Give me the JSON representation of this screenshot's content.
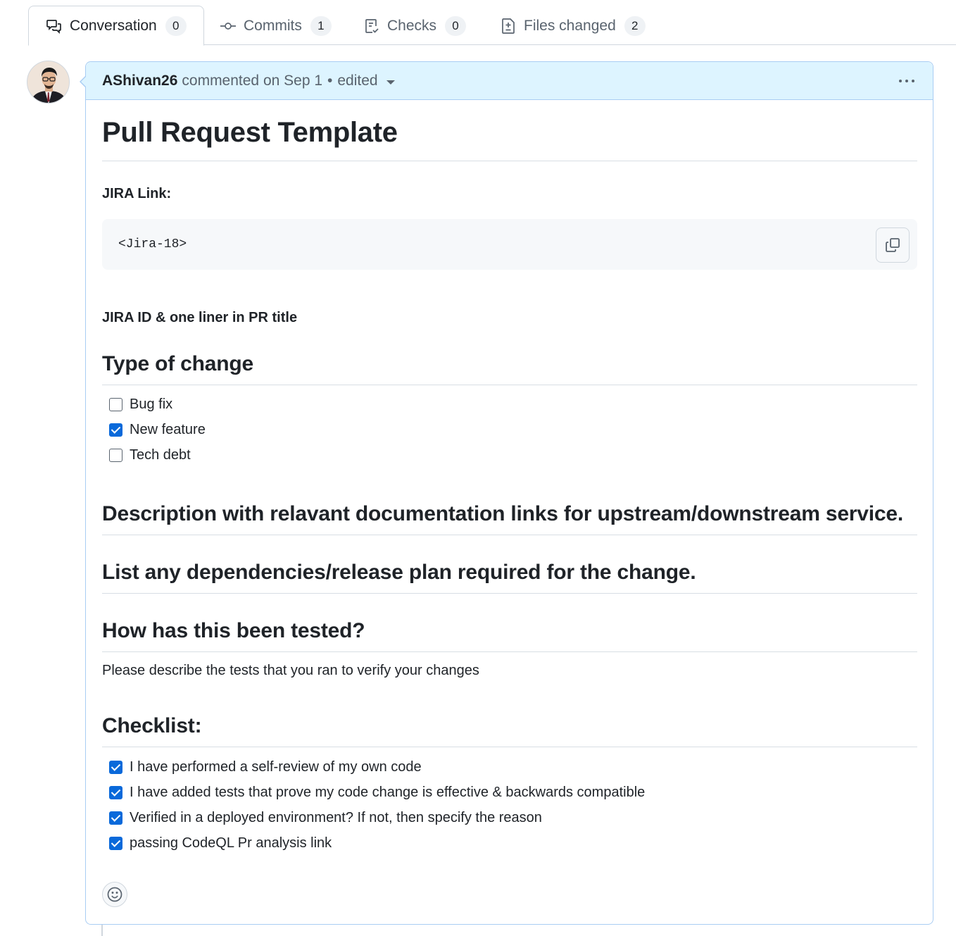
{
  "tabs": [
    {
      "label": "Conversation",
      "count": "0",
      "icon": "comment-discussion-icon",
      "active": true
    },
    {
      "label": "Commits",
      "count": "1",
      "icon": "git-commit-icon",
      "active": false
    },
    {
      "label": "Checks",
      "count": "0",
      "icon": "checklist-icon",
      "active": false
    },
    {
      "label": "Files changed",
      "count": "2",
      "icon": "file-diff-icon",
      "active": false
    }
  ],
  "comment": {
    "author": "AShivan26",
    "meta": "commented on Sep 1",
    "separator": "•",
    "edited": "edited"
  },
  "content": {
    "title": "Pull Request Template",
    "jira_label": "JIRA Link:",
    "jira_code": "<Jira-18>",
    "jira_note": "JIRA ID & one liner in PR title",
    "type_heading": "Type of change",
    "type_items": [
      {
        "label": "Bug fix",
        "checked": false
      },
      {
        "label": "New feature",
        "checked": true
      },
      {
        "label": "Tech debt",
        "checked": false
      }
    ],
    "description_heading": "Description with relavant documentation links for upstream/downstream service.",
    "dependencies_heading": "List any dependencies/release plan required for the change.",
    "tested_heading": "How has this been tested?",
    "tested_text": "Please describe the tests that you ran to verify your changes",
    "checklist_heading": "Checklist:",
    "checklist_items": [
      {
        "label": "I have performed a self-review of my own code",
        "checked": true
      },
      {
        "label": "I have added tests that prove my code change is effective & backwards compatible",
        "checked": true
      },
      {
        "label": "Verified in a deployed environment? If not, then specify the reason",
        "checked": true
      },
      {
        "label": "passing CodeQL Pr analysis link",
        "checked": true
      }
    ]
  },
  "colors": {
    "accent": "#0969da",
    "header_bg": "#ddf4ff",
    "header_border": "#a9cdf3"
  }
}
